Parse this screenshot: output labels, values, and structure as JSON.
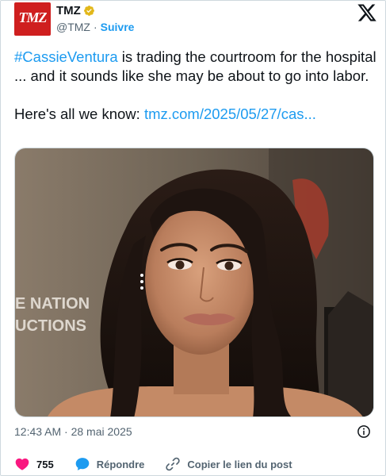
{
  "author": {
    "display_name": "TMZ",
    "handle": "@TMZ",
    "separator": "·",
    "follow_label": "Suivre",
    "avatar_text": "TMZ"
  },
  "tweet": {
    "hashtag": "#CassieVentura",
    "text_line1": " is trading the courtroom for the hospital ... and it sounds like she may be about to go into labor.",
    "text_line2_prefix": "Here's all we know: ",
    "link": "tmz.com/2025/05/27/cas..."
  },
  "meta": {
    "timestamp": "12:43 AM · 28 mai 2025"
  },
  "actions": {
    "like_count": "755",
    "reply_label": "Répondre",
    "copy_link_label": "Copier le lien du post"
  },
  "icons": {
    "verified": "verified-badge-icon",
    "platform": "x-logo-icon",
    "info": "info-icon",
    "like": "heart-icon",
    "reply": "reply-bubble-icon",
    "copy_link": "link-icon"
  },
  "colors": {
    "accent": "#1d9bf0",
    "verified_gold": "#e2b719",
    "like_pink": "#f91880",
    "avatar_red": "#cf1f1f",
    "text_secondary": "#536471"
  }
}
